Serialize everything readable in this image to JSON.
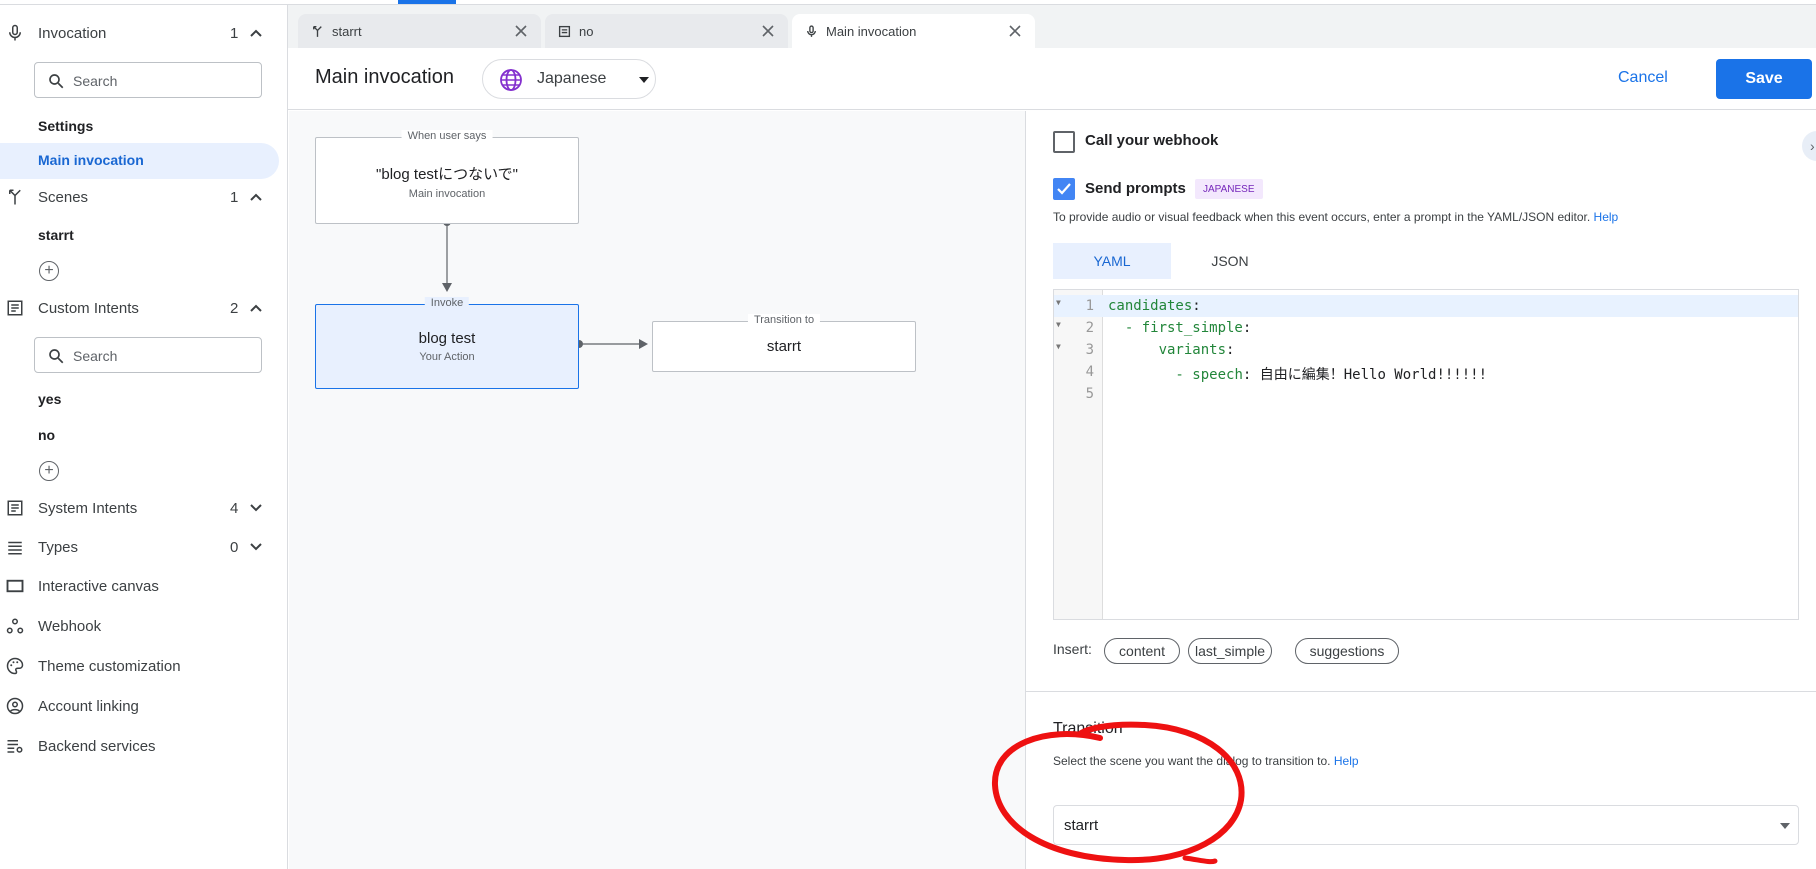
{
  "sidebar": {
    "invocation": {
      "label": "Invocation",
      "count": "1",
      "search_placeholder": "Search",
      "items": [
        "Settings",
        "Main invocation"
      ]
    },
    "scenes": {
      "label": "Scenes",
      "count": "1",
      "items": [
        "starrt"
      ]
    },
    "custom_intents": {
      "label": "Custom Intents",
      "count": "2",
      "search_placeholder": "Search",
      "items": [
        "yes",
        "no"
      ]
    },
    "system_intents": {
      "label": "System Intents",
      "count": "4"
    },
    "types": {
      "label": "Types",
      "count": "0"
    },
    "interactive_canvas": "Interactive canvas",
    "webhook": "Webhook",
    "theme": "Theme customization",
    "account_linking": "Account linking",
    "backend": "Backend services"
  },
  "tabs": [
    {
      "label": "starrt",
      "icon": "scene-icon"
    },
    {
      "label": "no",
      "icon": "intent-icon"
    },
    {
      "label": "Main invocation",
      "icon": "mic-icon",
      "active": true
    }
  ],
  "header": {
    "title": "Main invocation",
    "language": "Japanese",
    "cancel": "Cancel",
    "save": "Save"
  },
  "flow": {
    "trigger": {
      "tag": "When user says",
      "main": "\"blog testにつないで\"",
      "sub": "Main invocation"
    },
    "invoke": {
      "tag": "Invoke",
      "main": "blog test",
      "sub": "Your Action"
    },
    "transition": {
      "tag": "Transition to",
      "main": "starrt"
    }
  },
  "panel": {
    "webhook_label": "Call your webhook",
    "webhook_checked": false,
    "prompts_label": "Send prompts",
    "prompts_checked": true,
    "prompts_badge": "JAPANESE",
    "prompts_desc": "To provide audio or visual feedback when this event occurs, enter a prompt in the YAML/JSON editor.",
    "help": "Help",
    "tab_yaml": "YAML",
    "tab_json": "JSON",
    "code_lines": [
      {
        "n": "1",
        "key": "candidates",
        "rest": ":"
      },
      {
        "n": "2",
        "indent": "  - ",
        "key": "first_simple",
        "rest": ":"
      },
      {
        "n": "3",
        "indent": "      ",
        "key": "variants",
        "rest": ":"
      },
      {
        "n": "4",
        "indent": "        - ",
        "key": "speech",
        "rest": ": 自由に編集！Hello World!!!!!!"
      },
      {
        "n": "5"
      }
    ],
    "insert_label": "Insert:",
    "insert_chips": [
      "content",
      "last_simple",
      "suggestions"
    ],
    "transition_title": "Transition",
    "transition_desc": "Select the scene you want the dialog to transition to.",
    "transition_value": "starrt"
  },
  "colors": {
    "accent": "#1a73e8",
    "selected_bg": "#e8f0fe",
    "annotation": "#ee1111"
  }
}
